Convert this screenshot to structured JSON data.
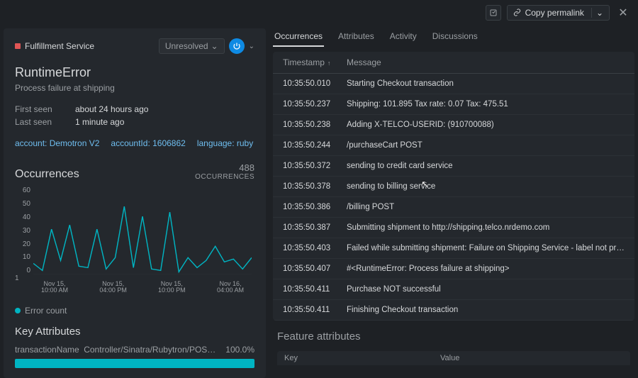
{
  "topbar": {
    "copy_permalink": "Copy permalink"
  },
  "service": {
    "name": "Fulfillment Service",
    "status_label": "Unresolved"
  },
  "error": {
    "title": "RuntimeError",
    "subtitle": "Process failure at shipping",
    "first_seen_label": "First seen",
    "first_seen_value": "about 24 hours ago",
    "last_seen_label": "Last seen",
    "last_seen_value": "1 minute ago"
  },
  "tags": {
    "account": "account: Demotron V2",
    "accountId": "accountId: 1606862",
    "language": "language: ruby"
  },
  "occurrences": {
    "title": "Occurrences",
    "count": "488",
    "count_label": "OCCURRENCES",
    "legend": "Error count",
    "scroll_hint": "1"
  },
  "chart_data": {
    "type": "line",
    "title": "Occurrences",
    "ylabel": "",
    "ylim": [
      0,
      60
    ],
    "y_ticks": [
      60,
      50,
      40,
      30,
      20,
      10,
      0
    ],
    "x_ticks": [
      {
        "l1": "Nov 15,",
        "l2": "10:00 AM"
      },
      {
        "l1": "Nov 15,",
        "l2": "04:00 PM"
      },
      {
        "l1": "Nov 15,",
        "l2": "10:00 PM"
      },
      {
        "l1": "Nov 16,",
        "l2": "04:00 AM"
      }
    ],
    "series": [
      {
        "name": "Error count",
        "values": [
          8,
          3,
          32,
          10,
          35,
          6,
          5,
          32,
          4,
          12,
          48,
          5,
          41,
          4,
          3,
          44,
          2,
          12,
          5,
          10,
          20,
          9,
          11,
          4,
          12
        ]
      }
    ]
  },
  "key_attributes": {
    "title": "Key Attributes",
    "name": "transactionName",
    "value": "Controller/Sinatra/Rubytron/POS…",
    "pct": "100.0%"
  },
  "tabs": {
    "occurrences": "Occurrences",
    "attributes": "Attributes",
    "activity": "Activity",
    "discussions": "Discussions"
  },
  "log": {
    "col_ts": "Timestamp",
    "col_msg": "Message",
    "rows": [
      {
        "ts": "10:35:50.010",
        "msg": "Starting Checkout transaction"
      },
      {
        "ts": "10:35:50.237",
        "msg": "Shipping: 101.895 Tax rate: 0.07 Tax: 475.51"
      },
      {
        "ts": "10:35:50.238",
        "msg": "Adding X-TELCO-USERID: (910700088)"
      },
      {
        "ts": "10:35:50.244",
        "msg": "/purchaseCart POST"
      },
      {
        "ts": "10:35:50.372",
        "msg": "sending to credit card service"
      },
      {
        "ts": "10:35:50.378",
        "msg": "sending to billing service"
      },
      {
        "ts": "10:35:50.386",
        "msg": "/billing POST"
      },
      {
        "ts": "10:35:50.387",
        "msg": "Submitting shipment to http://shipping.telco.nrdemo.com"
      },
      {
        "ts": "10:35:50.403",
        "msg": "Failed while submitting shipment: Failure on Shipping Service - label not provid…"
      },
      {
        "ts": "10:35:50.407",
        "msg": "#<RuntimeError: Process failure at shipping>"
      },
      {
        "ts": "10:35:50.411",
        "msg": "Purchase NOT successful"
      },
      {
        "ts": "10:35:50.411",
        "msg": "Finishing Checkout transaction"
      }
    ]
  },
  "feature_attrs": {
    "title": "Feature attributes",
    "col_key": "Key",
    "col_value": "Value"
  }
}
